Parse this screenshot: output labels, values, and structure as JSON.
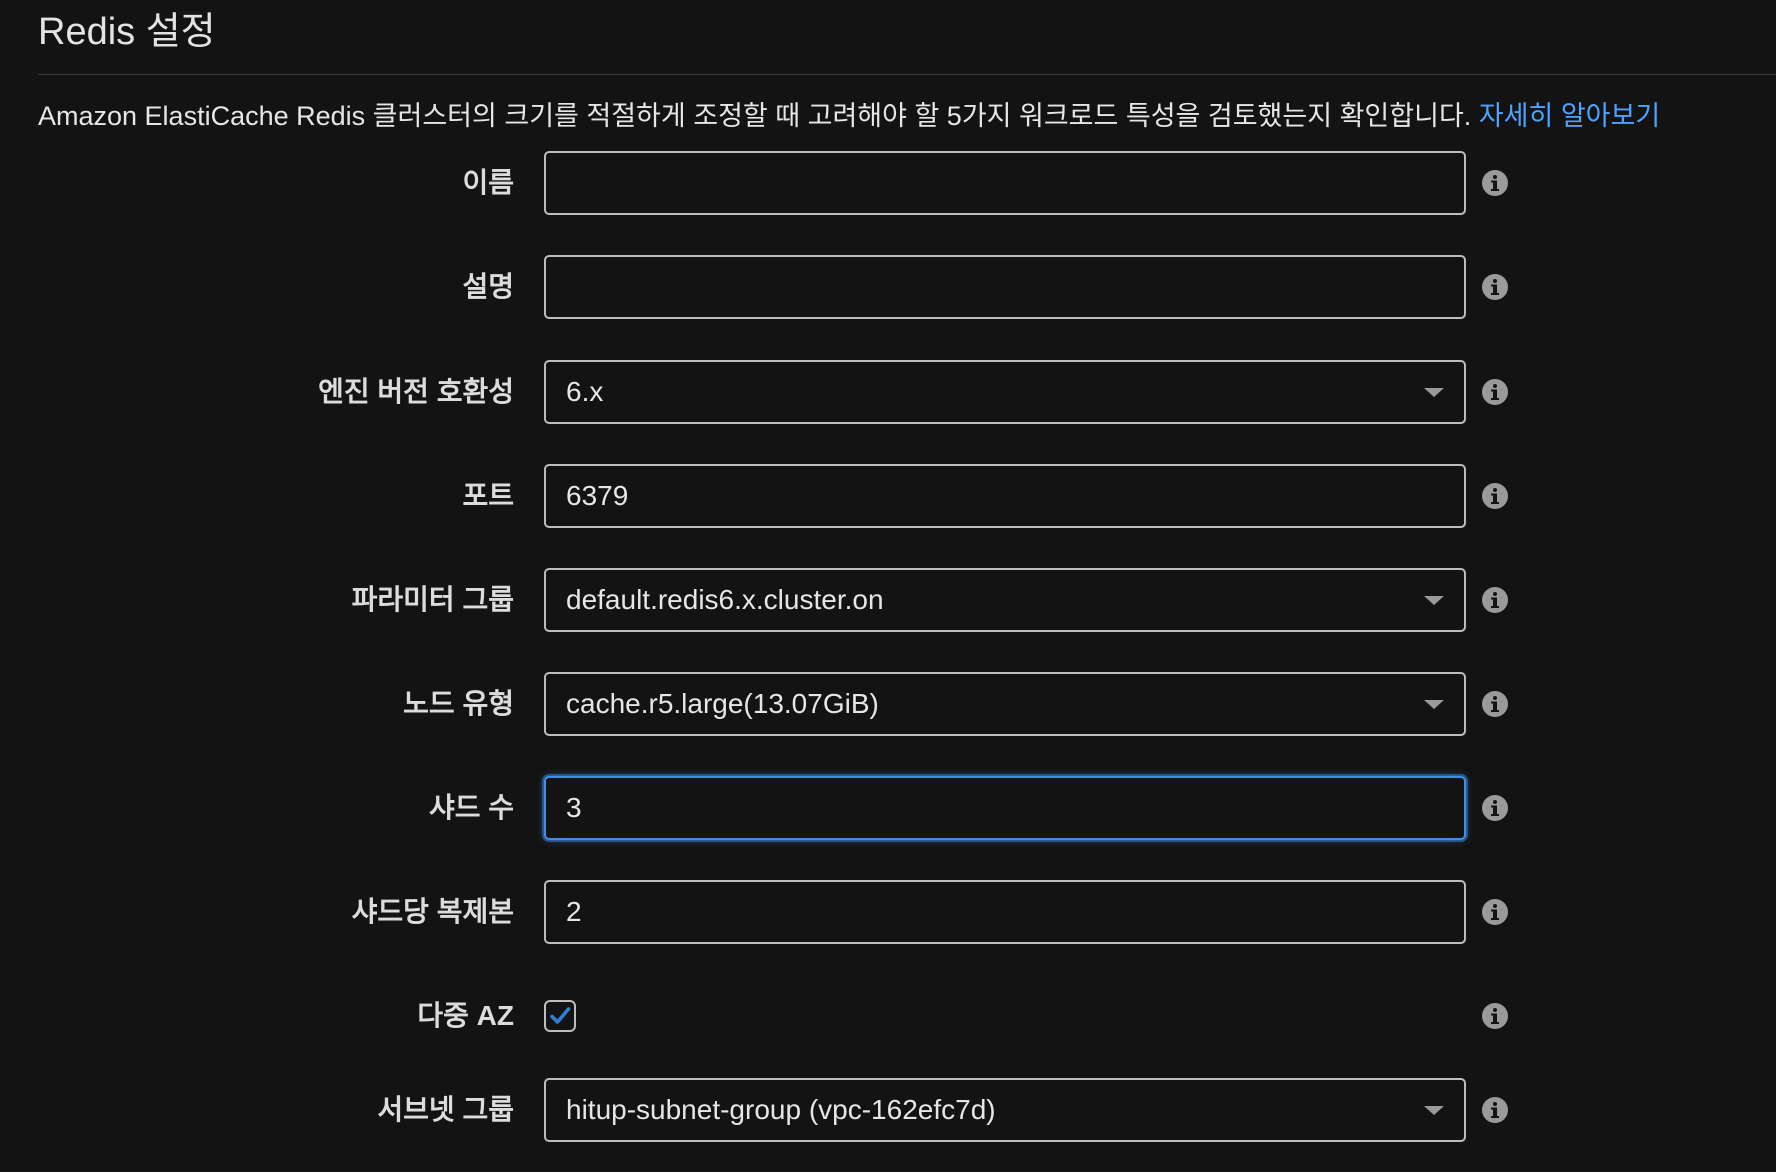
{
  "section": {
    "title": "Redis 설정",
    "intro_text": "Amazon ElastiCache Redis 클러스터의 크기를 적절하게 조정할 때 고려해야 할 5가지 워크로드 특성을 검토했는지 확인합니다.",
    "learn_more": "자세히 알아보기"
  },
  "fields": {
    "name": {
      "label": "이름",
      "value": ""
    },
    "description": {
      "label": "설명",
      "value": ""
    },
    "engine_version": {
      "label": "엔진 버전 호환성",
      "value": "6.x"
    },
    "port": {
      "label": "포트",
      "value": "6379"
    },
    "parameter_group": {
      "label": "파라미터 그룹",
      "value": "default.redis6.x.cluster.on"
    },
    "node_type": {
      "label": "노드 유형",
      "value": "cache.r5.large(13.07GiB)"
    },
    "shards": {
      "label": "샤드 수",
      "value": "3"
    },
    "replicas_per_shard": {
      "label": "샤드당 복제본",
      "value": "2"
    },
    "multi_az": {
      "label": "다중 AZ",
      "checked": true
    },
    "subnet_group": {
      "label": "서브넷 그룹",
      "value": "hitup-subnet-group (vpc-162efc7d)"
    }
  },
  "colors": {
    "background": "#131313",
    "link": "#4da3ff",
    "focus": "#3d8ee8",
    "checkbox_check": "#2f7fd6",
    "info_icon": "#9a9a9a"
  },
  "icons": {
    "info": "info-icon",
    "dropdown": "chevron-down-icon",
    "check": "checkmark-icon"
  }
}
